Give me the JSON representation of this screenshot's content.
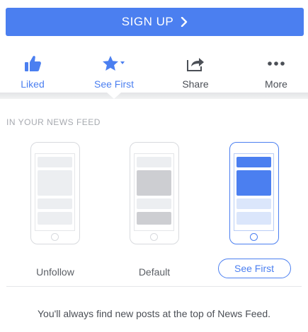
{
  "signup": {
    "label": "SIGN UP"
  },
  "actions": [
    {
      "label": "Liked",
      "icon": "thumbs-up-icon",
      "active": true
    },
    {
      "label": "See First",
      "icon": "star-icon",
      "active": true
    },
    {
      "label": "Share",
      "icon": "share-icon",
      "active": false
    },
    {
      "label": "More",
      "icon": "more-icon",
      "active": false
    }
  ],
  "news_feed": {
    "heading": "IN YOUR NEWS FEED",
    "options": [
      {
        "label": "Unfollow",
        "selected": false
      },
      {
        "label": "Default",
        "selected": false
      },
      {
        "label": "See First",
        "selected": true
      }
    ],
    "info": "You'll always find new posts at the top of News Feed."
  },
  "colors": {
    "brand_blue": "#4b7ff0",
    "text_dark": "#4b4f56",
    "text_muted": "#a7aab0",
    "block_light": "#eceef1",
    "block_gray": "#cdced2",
    "block_blue": "#4b7ff0",
    "block_pale_blue": "#dbe6fb"
  }
}
